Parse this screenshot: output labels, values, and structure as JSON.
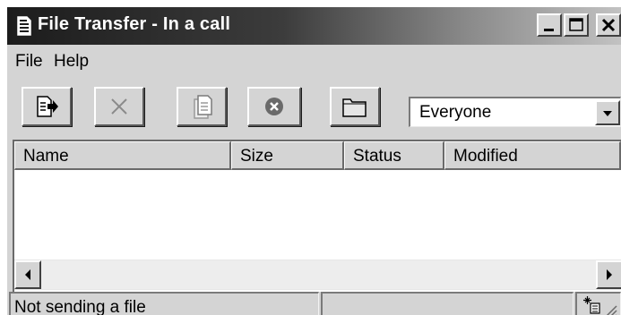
{
  "window": {
    "title": "File Transfer - In a call",
    "title_icon": "document-icon"
  },
  "caption_buttons": [
    "minimize",
    "maximize",
    "close"
  ],
  "menu": {
    "items": [
      {
        "label": "File"
      },
      {
        "label": "Help"
      }
    ]
  },
  "toolbar": {
    "buttons": [
      {
        "icon": "send-file-icon",
        "enabled": true
      },
      {
        "icon": "cancel-x-icon",
        "enabled": false
      },
      {
        "icon": "receive-file-icon",
        "enabled": false
      },
      {
        "icon": "stop-circle-icon",
        "enabled": true
      },
      {
        "icon": "folder-icon",
        "enabled": true
      }
    ],
    "recipient": {
      "value": "Everyone"
    }
  },
  "file_list": {
    "columns": [
      "Name",
      "Size",
      "Status",
      "Modified"
    ],
    "rows": []
  },
  "status_bar": {
    "text": "Not sending a file",
    "icon": "network-activity-icon"
  },
  "colors": {
    "face": "#d4d4d4",
    "title_gradient_start": "#1c1c1c",
    "title_gradient_end": "#c2c2c2"
  }
}
